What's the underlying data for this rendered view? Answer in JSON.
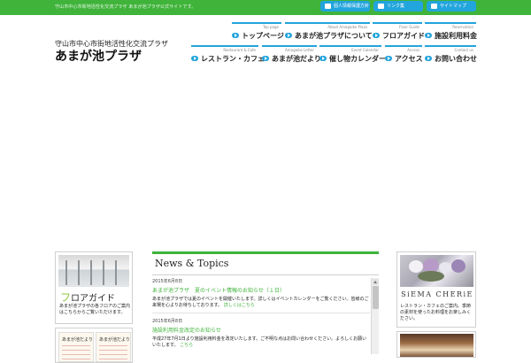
{
  "header": {
    "tagline": "守山市中心市街地活性化交流プラザ あまが池プラザ公式サイトです。",
    "subtitle": "守山市中心市街地活性化交流プラザ",
    "site_title": "あまが池プラザ"
  },
  "utility_nav": [
    {
      "label": "個人情報保護方針",
      "icon": "lock-icon"
    },
    {
      "label": "リンク集",
      "icon": "link-icon"
    },
    {
      "label": "サイトマップ",
      "icon": "sitemap-icon"
    }
  ],
  "nav_row1": [
    {
      "en": "Top page",
      "jp": "トップページ"
    },
    {
      "en": "About Amagaike Plaza",
      "jp": "あまが池プラザについて"
    },
    {
      "en": "Floor Guide",
      "jp": "フロアガイド"
    },
    {
      "en": "Reservation",
      "jp": "施設利用料金"
    }
  ],
  "nav_row2": [
    {
      "en": "Restaurant & Cafe",
      "jp": "レストラン・カフェ"
    },
    {
      "en": "Amagaike Letter",
      "jp": "あまが池だより"
    },
    {
      "en": "Event Calendar",
      "jp": "催し物カレンダー"
    },
    {
      "en": "Access",
      "jp": "アクセス"
    },
    {
      "en": "Contact us",
      "jp": "お問い合わせ"
    }
  ],
  "floor_guide": {
    "title_accent": "フ",
    "title_rest": "ロアガイド",
    "description": "あまが池プラザの各フロアのご案内はこちらからご覧いただけます。"
  },
  "letter": {
    "label_1": "あまが池だより",
    "label_2": "あまが池だより"
  },
  "news": {
    "title": "News & Topics",
    "items": [
      {
        "date": "2015年6月8日",
        "link": "あまが池プラザ　夏のイベント情報のお知らせ（１日）",
        "body": "あまが池プラザでは夏のイベントを開催いたします。詳しくはイベントカレンダーをご覧ください。皆様のご来場を心よりお待ちしております。",
        "body_link": "詳しくはこちら"
      },
      {
        "date": "2015年6月8日",
        "link": "施設利用料金改定のお知らせ",
        "body": "平成27年7月1日より施設利用料金を改定いたします。ご不明な点はお問い合わせください。よろしくお願いいたします。",
        "body_link": "こちら"
      }
    ]
  },
  "cafe": {
    "name": "SiEMA CHERiE",
    "description": "レストラン・カフェのご案内。季節の素材を使ったお料理をお楽しみください。"
  },
  "colors": {
    "brand_green": "#3fb33a",
    "accent_blue": "#22a4dc",
    "light_green": "#8cc63f"
  }
}
